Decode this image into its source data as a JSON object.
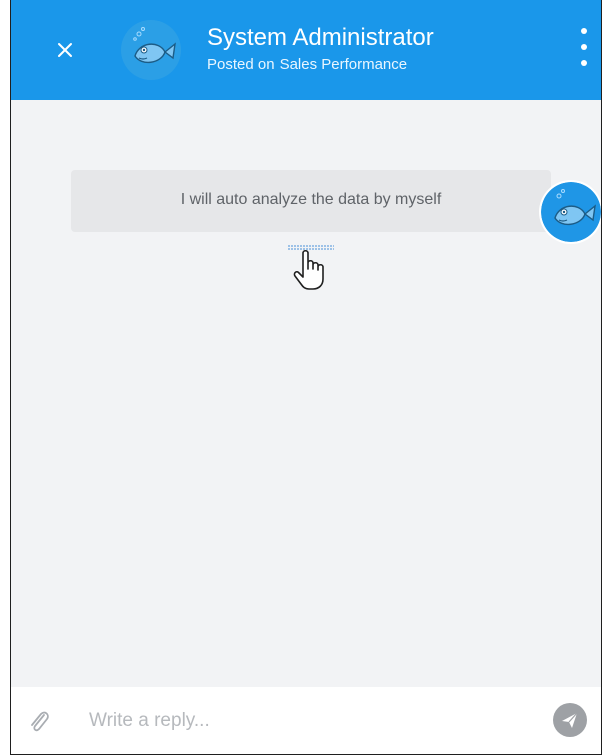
{
  "header": {
    "author_name": "System Administrator",
    "posted_on_label": "Posted on",
    "posted_target": "Sales Performance",
    "close_icon": "close-icon",
    "menu_icon": "more-vertical-icon",
    "avatar_icon": "fish-avatar-icon",
    "background_color": "#1a97ea"
  },
  "conversation": {
    "messages": [
      {
        "text": "I will auto analyze the data by myself",
        "avatar_icon": "fish-avatar-icon"
      }
    ],
    "hover_cursor_icon": "hand-pointer-icon"
  },
  "reply": {
    "placeholder": "Write a reply...",
    "value": "",
    "attach_icon": "paperclip-icon",
    "send_icon": "send-icon"
  }
}
